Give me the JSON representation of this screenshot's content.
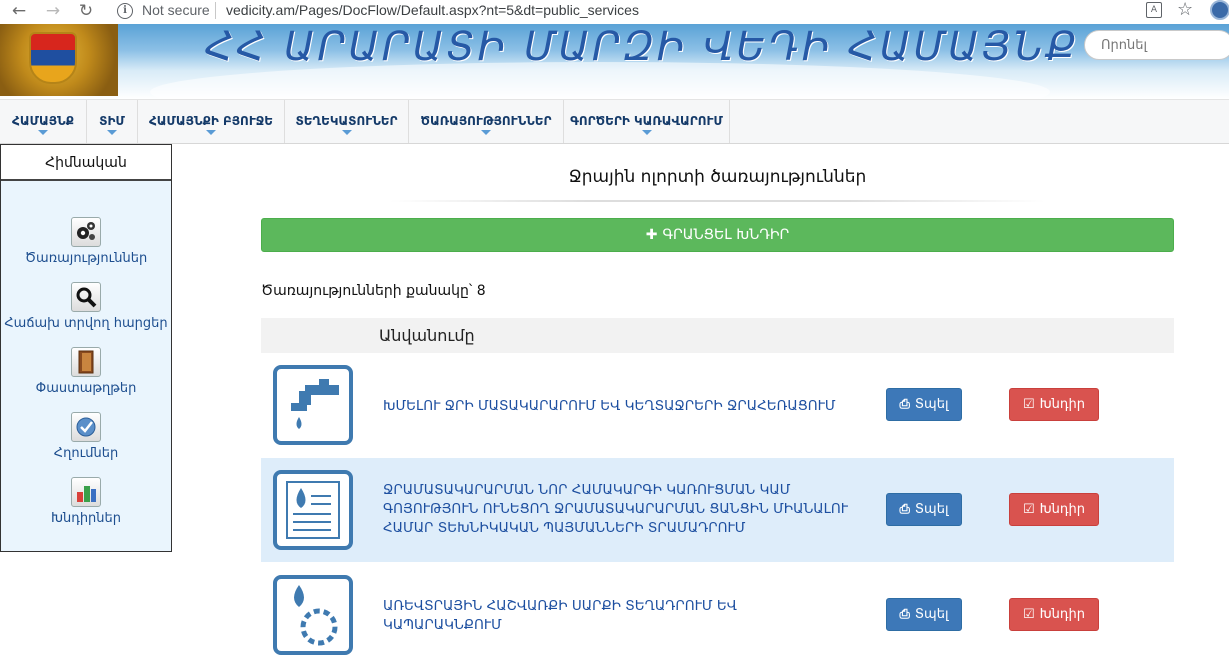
{
  "browser": {
    "back_icon": "arrow-left-icon",
    "forward_icon": "arrow-right-icon",
    "reload_icon": "reload-icon",
    "security_label": "Not secure",
    "url": "vedicity.am/Pages/DocFlow/Default.aspx?nt=5&dt=public_services",
    "info_icon": "info-icon",
    "translate_icon": "translate-icon",
    "star_icon": "star-icon",
    "profile_icon": "avatar-icon"
  },
  "header": {
    "title": "ՀՀ ԱՐԱՐԱՏԻ ՄԱՐԶԻ ՎԵԴԻ ՀԱՄԱՅՆՔ",
    "emblem_icon": "coat-of-arms-icon",
    "search_placeholder": "Որոնել"
  },
  "nav": {
    "items": [
      {
        "label": "ՀԱՄԱՅՆՔ"
      },
      {
        "label": "ՏԻՄ"
      },
      {
        "label": "ՀԱՄԱՅՆՔԻ ԲՅՈՒՋԵ"
      },
      {
        "label": "ՏԵՂԵԿԱՏՈՒՆԵՐ"
      },
      {
        "label": "ԾԱՌԱՅՈՒԹՅՈՒՆՆԵՐ"
      },
      {
        "label": "ԳՈՐԾԵՐԻ ԿԱՌԱՎԱՐՈՒՄ"
      }
    ]
  },
  "sidebar": {
    "header": "Հիմնական",
    "items": [
      {
        "label": "Ծառայություններ",
        "icon": "gears-icon"
      },
      {
        "label": "Հաճախ տրվող հարցեր",
        "icon": "magnifier-icon"
      },
      {
        "label": "Փաստաթղթեր",
        "icon": "document-folder-icon"
      },
      {
        "label": "Հղումներ",
        "icon": "link-globe-icon"
      },
      {
        "label": "Խնդիրներ",
        "icon": "chart-blocks-icon"
      }
    ]
  },
  "main": {
    "title": "Ջրային ոլորտի ծառայություններ",
    "register_button": "ԳՐԱՆՑԵԼ ԽՆԴԻՐ",
    "register_icon": "plus-icon",
    "count_label": "Ծառայությունների քանակը՝ 8",
    "table_header": "Անվանումը",
    "print_label": "Տպել",
    "request_label": "Խնդիր",
    "print_icon": "printer-icon",
    "request_icon": "check-square-icon",
    "rows": [
      {
        "name": "ԽՄԵԼՈՒ ՋՐԻ ՄԱՏԱԿԱՐԱՐՈՒՄ ԵՎ ԿԵՂՏԱՋՐԵՐԻ ՋՐԱՀԵՌԱՑՈՒՄ",
        "icon": "water-tap-icon"
      },
      {
        "name": "ՋՐԱՄԱՏԱԿԱՐԱՐՄԱՆ ՆՈՐ ՀԱՄԱԿԱՐԳԻ ԿԱՌՈՒՑՄԱՆ ԿԱՄ ԳՈՅՈՒԹՅՈՒՆ ՈՒՆԵՑՈՂ ՋՐԱՄԱՏԱԿԱՐԱՐՄԱՆ ՑԱՆՑԻՆ ՄԻԱՆԱԼՈՒ ՀԱՄԱՐ ՏԵԽՆԻԿԱԿԱՆ ՊԱՅՄԱՆՆԵՐԻ ՏՐԱՄԱԴՐՈՒՄ",
        "icon": "water-document-icon"
      },
      {
        "name": "ԱՌԵՎՏՐԱՅԻՆ ՀԱՇՎԱՌՔԻ ՍԱՐՔԻ ՏԵՂԱԴՐՈՒՄ ԵՎ ԿԱՊԱՐԱԿՆՔՈՒՄ",
        "icon": "water-meter-icon"
      }
    ]
  }
}
